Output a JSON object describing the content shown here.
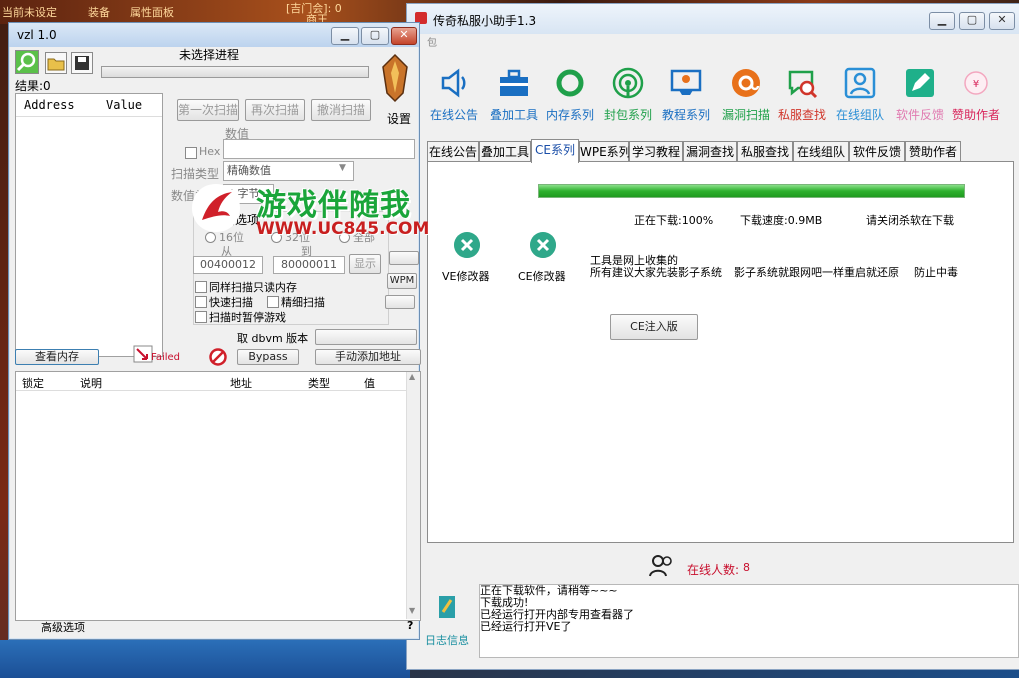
{
  "background": {
    "game_texts": [
      "当前未设定",
      "装备",
      "属性面板",
      "[吉门会]: 0",
      "商王"
    ]
  },
  "left_window": {
    "title": "vzl 1.0",
    "process_label": "未选择进程",
    "results_label": "结果:0",
    "settings_label": "设置",
    "columns": {
      "address": "Address",
      "value": "Value"
    },
    "scan_buttons": {
      "first": "第一次扫描",
      "next": "再次扫描",
      "undo": "撤消扫描"
    },
    "value_label": "数值",
    "hex_label": "Hex",
    "scan_type_label": "扫描类型",
    "scan_type_value": "精确数值",
    "value_type_label": "数值类型",
    "value_type_value": "4 字节",
    "scan_options_label": "扫描选项",
    "bits16_label": "16位",
    "bits32_label": "32位",
    "all_label": "全部",
    "from_label": "从",
    "to_label": "到",
    "from_value": "00400012",
    "to_value": "80000011",
    "show_button": "显示",
    "wpm_button": "WPM",
    "options": [
      "同样扫描只读内存",
      "快速扫描",
      "精细扫描",
      "扫描时暂停游戏"
    ],
    "dbvm_label": "取 dbvm 版本",
    "view_memory": "查看内存",
    "failed_label": "Failed",
    "bypass_button": "Bypass",
    "manual_add": "手动添加地址",
    "list_columns": {
      "lock": "锁定",
      "desc": "说明",
      "addr": "地址",
      "type": "类型",
      "value": "值"
    },
    "advanced": "高级选项",
    "help": "?"
  },
  "watermark": {
    "text": "游戏伴随我",
    "url": "WWW.UC845.COM"
  },
  "right_window": {
    "title": "传奇私服小助手1.3",
    "menu_fragment": "包",
    "icons": [
      {
        "label": "在线公告",
        "icon": "speaker-icon",
        "color": "#1a6fc2"
      },
      {
        "label": "叠加工具",
        "icon": "toolbox-icon",
        "color": "#1a6fc2"
      },
      {
        "label": "内存系列",
        "icon": "ring-icon",
        "color": "#1fa04a"
      },
      {
        "label": "封包系列",
        "icon": "signal-icon",
        "color": "#1fa04a"
      },
      {
        "label": "教程系列",
        "icon": "monitor-icon",
        "color": "#1a6fc2"
      },
      {
        "label": "漏洞扫描",
        "icon": "at-icon",
        "color": "#e8711a"
      },
      {
        "label": "私服查找",
        "icon": "chat-search-icon",
        "color": "#d0352a"
      },
      {
        "label": "在线组队",
        "icon": "team-icon",
        "color": "#2a8fd6"
      },
      {
        "label": "软件反馈",
        "icon": "edit-icon",
        "color": "#1fb08a"
      },
      {
        "label": "赞助作者",
        "icon": "sponsor-icon",
        "color": "#d8245a"
      }
    ],
    "tabs": [
      "在线公告",
      "叠加工具",
      "CE系列",
      "WPE系列",
      "学习教程",
      "漏洞查找",
      "私服查找",
      "在线组队",
      "软件反馈",
      "赞助作者"
    ],
    "active_tab": "CE系列",
    "download_progress": 100,
    "downloading": "正在下载:100%",
    "speed": "下载速度:0.9MB",
    "close_antivirus": "请关闭杀软在下载",
    "tools": [
      {
        "label": "VE修改器"
      },
      {
        "label": "CE修改器"
      }
    ],
    "info_line1": "工具是网上收集的",
    "info_line2": "所有建议大家先装影子系统",
    "info_line3": "影子系统就跟网吧一样重启就还原",
    "info_line4": "防止中毒",
    "ce_inject": "CE注入版",
    "online_label": "在线人数:",
    "online_count": "8",
    "log_label": "日志信息",
    "log_lines": [
      "正在下载软件，请稍等~~~",
      "下载成功!",
      "已经运行打开内部专用查看器了",
      "已经运行打开VE了"
    ]
  }
}
